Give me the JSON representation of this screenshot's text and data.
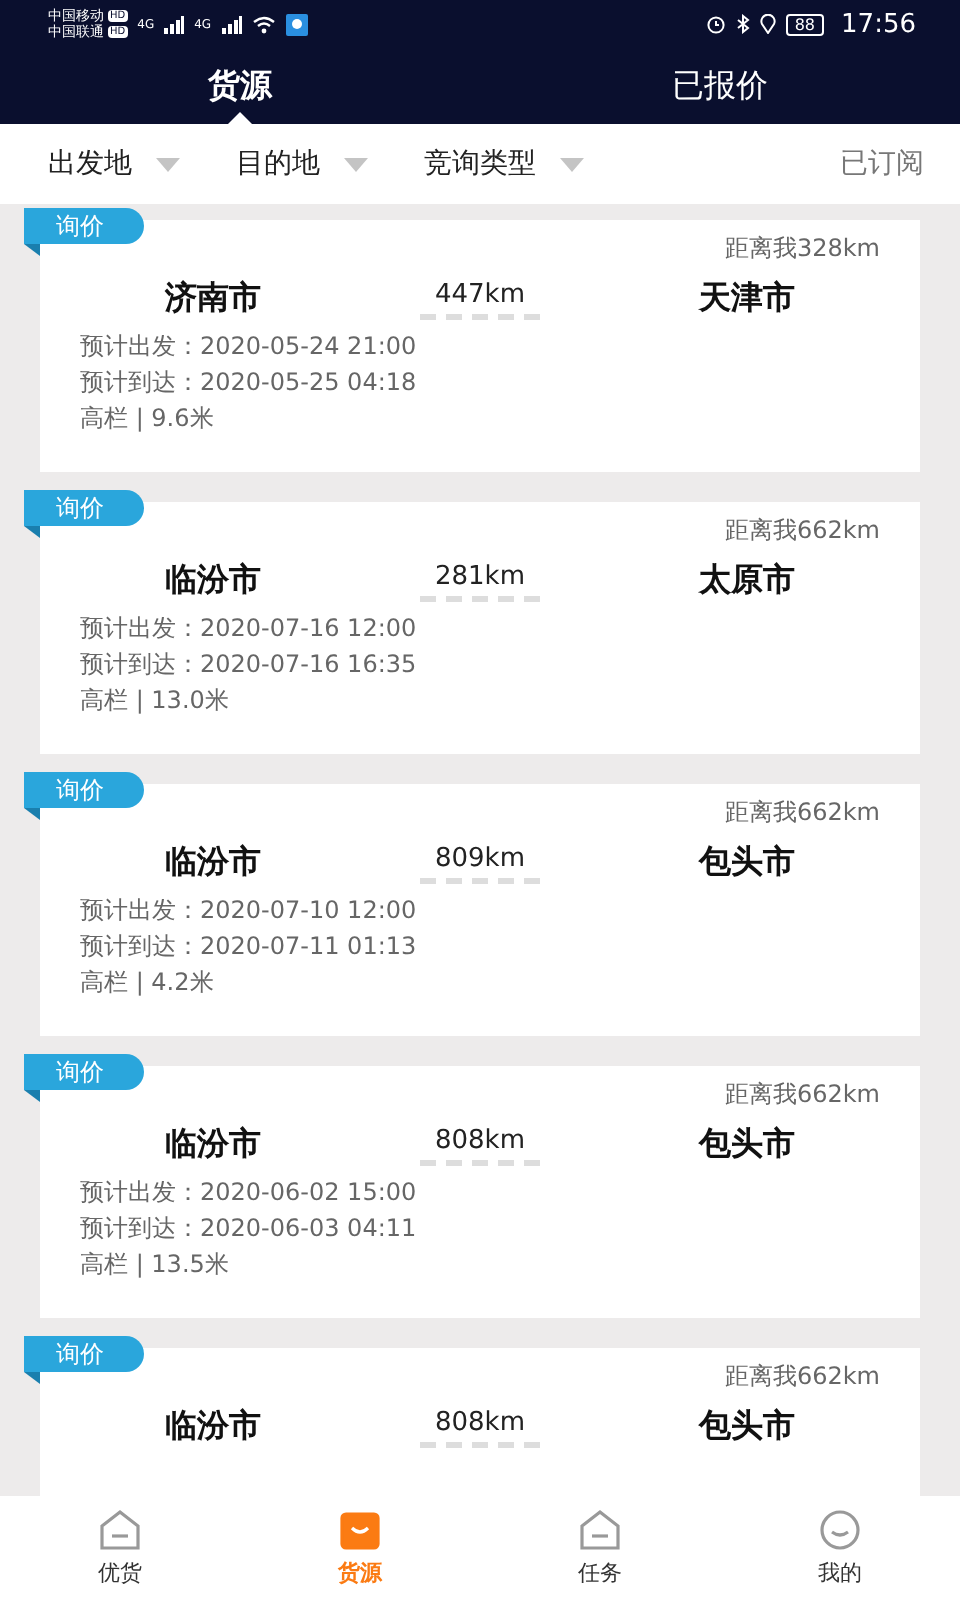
{
  "status_bar": {
    "carriers": [
      {
        "name": "中国移动",
        "badge": "HD"
      },
      {
        "name": "中国联通",
        "badge": "HD"
      }
    ],
    "networks": [
      "4G",
      "4G"
    ],
    "battery": "88",
    "time": "17:56"
  },
  "tabs": [
    {
      "label": "货源",
      "selected": true
    },
    {
      "label": "已报价",
      "selected": false
    }
  ],
  "filters": [
    {
      "label": "出发地"
    },
    {
      "label": "目的地"
    },
    {
      "label": "竞询类型"
    }
  ],
  "subscribed": "已订阅",
  "cards": [
    {
      "tag": "询价",
      "nearby": "距离我328km",
      "from": "济南市",
      "distance": "447km",
      "to": "天津市",
      "details": [
        "预计出发：2020-05-24 21:00",
        "预计到达：2020-05-25 04:18",
        "高栏 | 9.6米"
      ]
    },
    {
      "tag": "询价",
      "nearby": "距离我662km",
      "from": "临汾市",
      "distance": "281km",
      "to": "太原市",
      "details": [
        "预计出发：2020-07-16 12:00",
        "预计到达：2020-07-16 16:35",
        "高栏 | 13.0米"
      ]
    },
    {
      "tag": "询价",
      "nearby": "距离我662km",
      "from": "临汾市",
      "distance": "809km",
      "to": "包头市",
      "details": [
        "预计出发：2020-07-10 12:00",
        "预计到达：2020-07-11 01:13",
        "高栏 | 4.2米"
      ]
    },
    {
      "tag": "询价",
      "nearby": "距离我662km",
      "from": "临汾市",
      "distance": "808km",
      "to": "包头市",
      "details": [
        "预计出发：2020-06-02 15:00",
        "预计到达：2020-06-03 04:11",
        "高栏 | 13.5米"
      ]
    },
    {
      "tag": "询价",
      "nearby": "距离我662km",
      "from": "临汾市",
      "distance": "808km",
      "to": "包头市"
    }
  ],
  "nav": [
    {
      "label": "优货",
      "kind": "box",
      "selected": false
    },
    {
      "label": "货源",
      "kind": "bag",
      "selected": true
    },
    {
      "label": "任务",
      "kind": "box",
      "selected": false
    },
    {
      "label": "我的",
      "kind": "face",
      "selected": false
    }
  ]
}
